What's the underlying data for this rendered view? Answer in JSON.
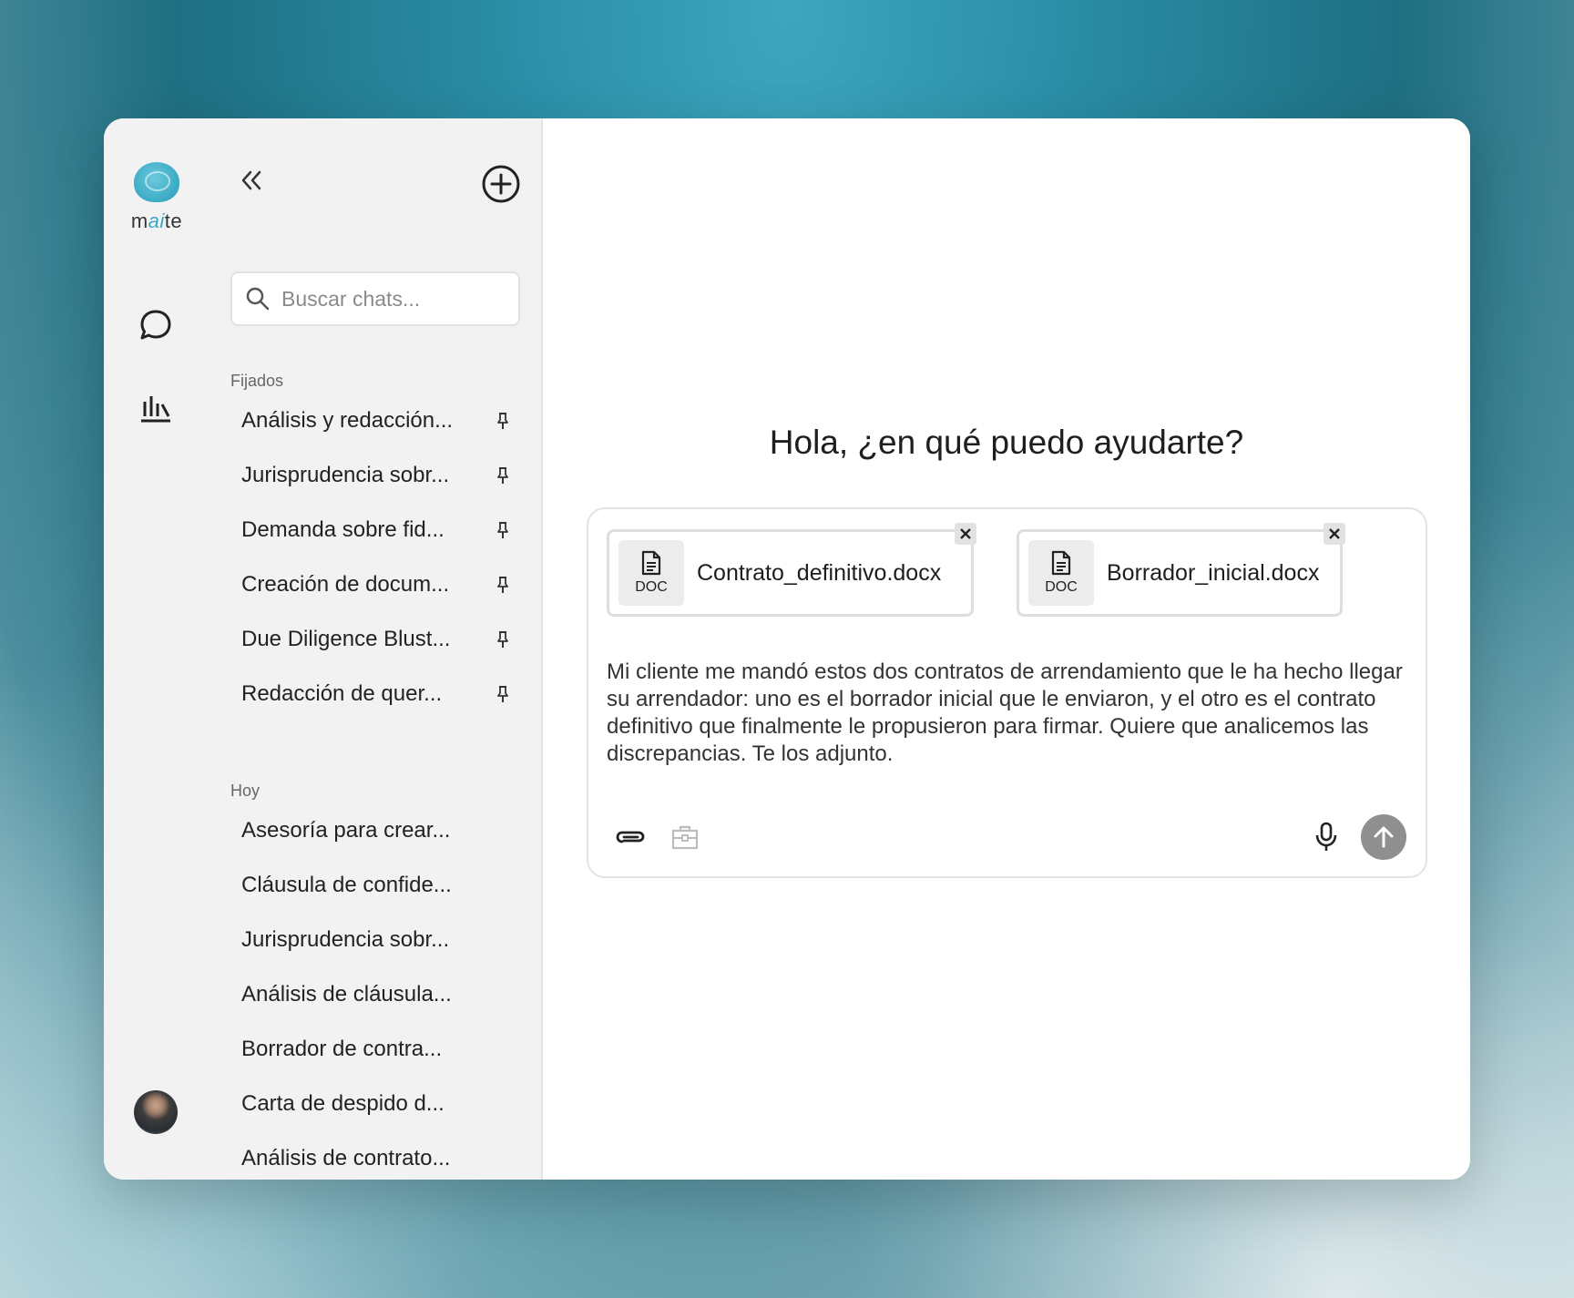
{
  "app": {
    "logo_text_pre": "m",
    "logo_text_ai": "ai",
    "logo_text_post": "te",
    "accent_color": "#3aaac4"
  },
  "rail": {
    "icons": [
      "chat-bubble-icon",
      "analytics-icon"
    ],
    "avatar": "user-avatar"
  },
  "sidebar": {
    "search_placeholder": "Buscar chats...",
    "pinned_label": "Fijados",
    "pinned": [
      {
        "label": "Análisis y redacción..."
      },
      {
        "label": "Jurisprudencia sobr..."
      },
      {
        "label": "Demanda sobre fid..."
      },
      {
        "label": "Creación de docum..."
      },
      {
        "label": "Due Diligence Blust..."
      },
      {
        "label": "Redacción de quer..."
      }
    ],
    "today_label": "Hoy",
    "today": [
      {
        "label": "Asesoría para crear..."
      },
      {
        "label": "Cláusula de confide..."
      },
      {
        "label": "Jurisprudencia sobr..."
      },
      {
        "label": "Análisis de cláusula..."
      },
      {
        "label": "Borrador de contra..."
      },
      {
        "label": "Carta de despido d..."
      },
      {
        "label": "Análisis de contrato..."
      }
    ]
  },
  "main": {
    "greeting": "Hola, ¿en qué puedo ayudarte?",
    "attachments": [
      {
        "type": "DOC",
        "name": "Contrato_definitivo.docx"
      },
      {
        "type": "DOC",
        "name": "Borrador_inicial.docx"
      }
    ],
    "message": "Mi cliente me mandó  estos dos contratos de arrendamiento que le ha hecho llegar su arrendador: uno es el borrador inicial que le enviaron, y el otro es el contrato definitivo que finalmente le propusieron para firmar. Quiere que analicemos las discrepancias. Te los adjunto."
  }
}
